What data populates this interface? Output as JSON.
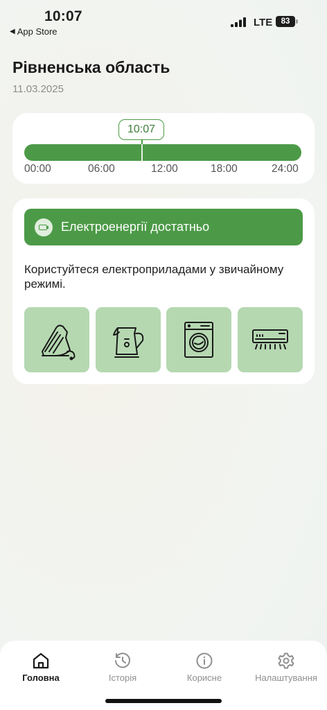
{
  "status_bar": {
    "time": "10:07",
    "back_label": "App Store",
    "network": "LTE",
    "battery": "83"
  },
  "header": {
    "region": "Рівненська область",
    "date": "11.03.2025"
  },
  "timeline": {
    "current_time": "10:07",
    "ticks": [
      "00:00",
      "06:00",
      "12:00",
      "18:00",
      "24:00"
    ],
    "bar_color": "#4c9a47"
  },
  "status": {
    "banner": "Електроенергії достатньо",
    "advice": "Користуйтеся електроприладами у звичайному режимі.",
    "appliances": [
      "iron-icon",
      "kettle-icon",
      "washing-machine-icon",
      "air-conditioner-icon"
    ]
  },
  "tabs": [
    {
      "label": "Головна",
      "icon": "home-icon",
      "active": true
    },
    {
      "label": "Історія",
      "icon": "history-icon",
      "active": false
    },
    {
      "label": "Корисне",
      "icon": "info-icon",
      "active": false
    },
    {
      "label": "Налаштування",
      "icon": "gear-icon",
      "active": false
    }
  ],
  "colors": {
    "accent": "#4c9a47",
    "appliance_tile": "#b5d8b1"
  }
}
